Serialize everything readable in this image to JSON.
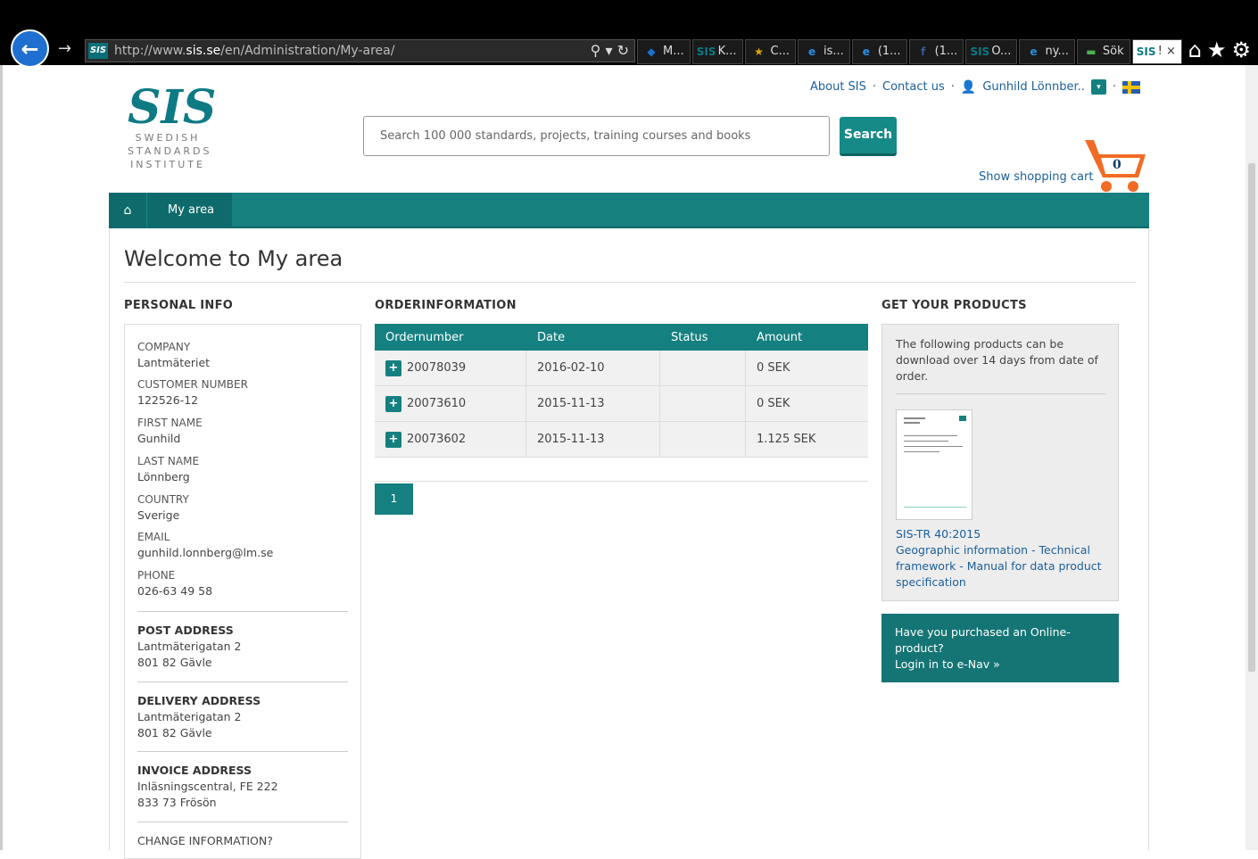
{
  "browser": {
    "url_prefix": "http://www.",
    "url_domain": "sis.se",
    "url_path": "/en/Administration/My-area/",
    "tabs": [
      {
        "icon": "◆",
        "label": "M...",
        "color": "#1a6fd0",
        "active": false
      },
      {
        "icon": "SIS",
        "label": "K...",
        "color": "#0e7a84",
        "active": false
      },
      {
        "icon": "★",
        "label": "C...",
        "color": "#e0a800",
        "active": false
      },
      {
        "icon": "e",
        "label": "is...",
        "color": "#2a8fe0",
        "active": false
      },
      {
        "icon": "e",
        "label": "(1...",
        "color": "#2a8fe0",
        "active": false
      },
      {
        "icon": "f",
        "label": "(1...",
        "color": "#3b5998",
        "active": false
      },
      {
        "icon": "SIS",
        "label": "O...",
        "color": "#0e7a84",
        "active": false
      },
      {
        "icon": "e",
        "label": "ny...",
        "color": "#2a8fe0",
        "active": false
      },
      {
        "icon": "▬",
        "label": "Sök",
        "color": "#4caf50",
        "active": false
      },
      {
        "icon": "SIS",
        "label": "! ×",
        "color": "#0e7a84",
        "active": true
      }
    ]
  },
  "header": {
    "logo_mark": "SIS",
    "logo_lines": [
      "SWEDISH",
      "STANDARDS",
      "INSTITUTE"
    ],
    "links": {
      "about": "About SIS",
      "contact": "Contact us",
      "user": "Gunhild Lönnber.."
    },
    "search_placeholder": "Search 100 000 standards, projects, training courses and books",
    "search_button": "Search",
    "cart_count": "0",
    "cart_link": "Show shopping cart"
  },
  "nav": {
    "current": "My area"
  },
  "page": {
    "title": "Welcome to My area",
    "personal_heading": "PERSONAL INFO",
    "order_heading": "ORDERINFORMATION",
    "products_heading": "GET YOUR PRODUCTS"
  },
  "personal": {
    "fields": [
      {
        "label": "COMPANY",
        "value": "Lantmäteriet"
      },
      {
        "label": "CUSTOMER NUMBER",
        "value": "122526-12"
      },
      {
        "label": "FIRST NAME",
        "value": "Gunhild"
      },
      {
        "label": "LAST NAME",
        "value": "Lönnberg"
      },
      {
        "label": "COUNTRY",
        "value": "Sverige"
      },
      {
        "label": "EMAIL",
        "value": "gunhild.lonnberg@lm.se"
      },
      {
        "label": "PHONE",
        "value": "026-63 49 58"
      }
    ],
    "post": {
      "label": "POST ADDRESS",
      "line1": "Lantmäterigatan 2",
      "line2": "801 82 Gävle"
    },
    "delivery": {
      "label": "DELIVERY ADDRESS",
      "line1": "Lantmäterigatan 2",
      "line2": "801 82 Gävle"
    },
    "invoice": {
      "label": "INVOICE ADDRESS",
      "line1": "Inläsningscentral, FE 222",
      "line2": "833 73 Frösön"
    },
    "change": "CHANGE INFORMATION?"
  },
  "orders": {
    "columns": [
      "Ordernumber",
      "Date",
      "Status",
      "Amount"
    ],
    "rows": [
      {
        "number": "20078039",
        "date": "2016-02-10",
        "status": "",
        "amount": "0 SEK"
      },
      {
        "number": "20073610",
        "date": "2015-11-13",
        "status": "",
        "amount": "0 SEK"
      },
      {
        "number": "20073602",
        "date": "2015-11-13",
        "status": "",
        "amount": "1.125 SEK"
      }
    ],
    "page": "1"
  },
  "products": {
    "intro": "The following products can be download over 14 days from date of order.",
    "code": "SIS-TR 40:2015",
    "name": "Geographic information - Technical framework - Manual for data product specification"
  },
  "enav": {
    "line1": "Have you purchased an Online-",
    "line2": "product?",
    "line3": "Login in to e-Nav »"
  }
}
